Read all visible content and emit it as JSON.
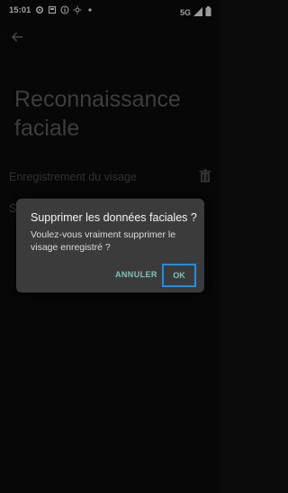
{
  "status_bar": {
    "time": "15:01",
    "network": "5G",
    "left_icons": [
      "settings-icon",
      "screenshot-icon",
      "info-icon",
      "brightness-icon",
      "dot-icon"
    ],
    "right_icons": [
      "signal-icon",
      "battery-icon"
    ]
  },
  "header": {
    "back_icon": "arrow-back-icon",
    "title": "Reconnaissance faciale"
  },
  "settings": {
    "row1_label": "Enregistrement du visage",
    "row1_icon": "trash-icon",
    "row2_label": "S"
  },
  "dialog": {
    "title": "Supprimer les données faciales ?",
    "message": "Voulez-vous vraiment supprimer le visage enregistré ?",
    "cancel_label": "ANNULER",
    "ok_label": "OK",
    "accent_color": "#7fc3bf",
    "focus_color": "#1e8fe6"
  }
}
